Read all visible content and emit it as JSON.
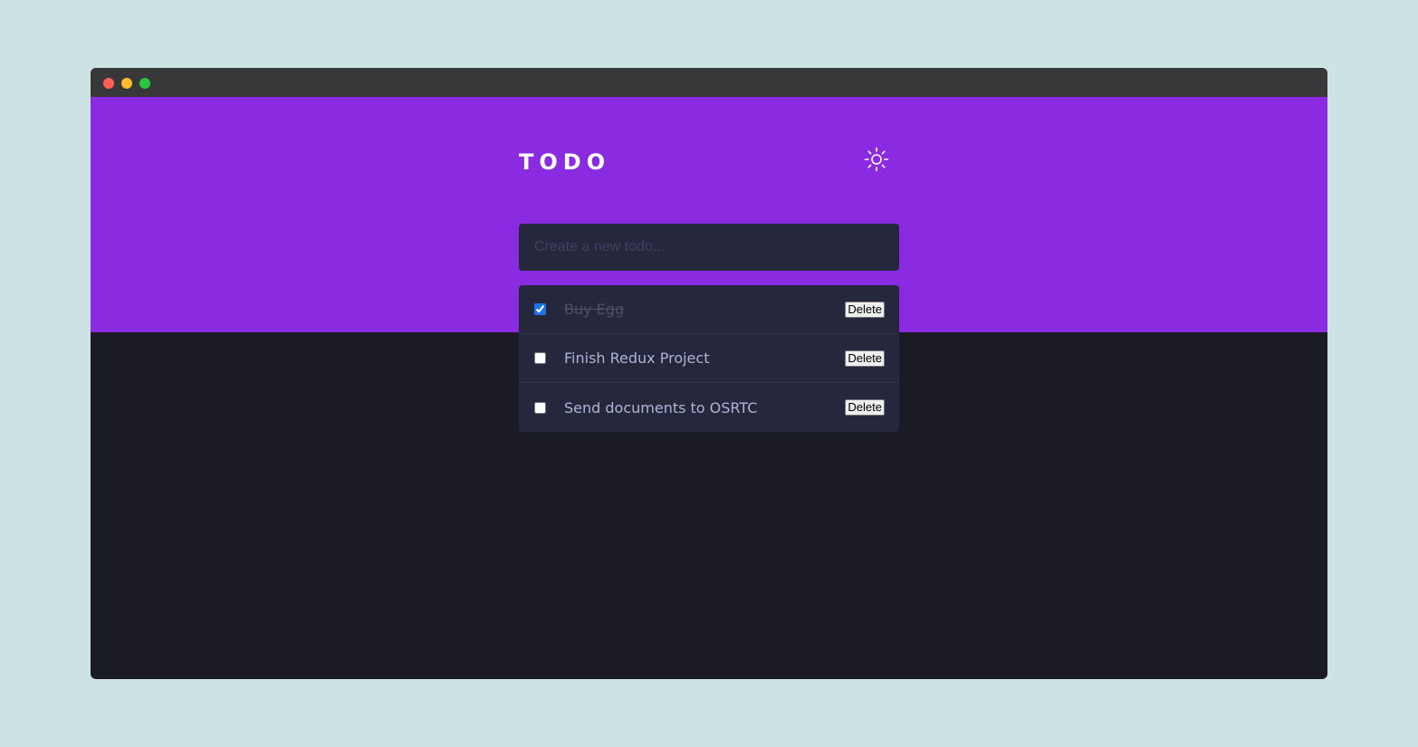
{
  "colors": {
    "page_background": "#cce2e3",
    "titlebar": "#38383a",
    "hero_background": "#8a2be2",
    "app_background": "#1a1b24",
    "panel": "#25273d",
    "close_dot": "#fe5f57",
    "minimize_dot": "#febc2e",
    "maximize_dot": "#28c840"
  },
  "header": {
    "title": "TODO",
    "theme_icon": "sun-icon"
  },
  "new_todo": {
    "placeholder": "Create a new todo...",
    "value": ""
  },
  "todos": [
    {
      "text": "Buy Egg",
      "completed": true,
      "delete_label": "Delete"
    },
    {
      "text": "Finish Redux Project",
      "completed": false,
      "delete_label": "Delete"
    },
    {
      "text": "Send documents to OSRTC",
      "completed": false,
      "delete_label": "Delete"
    }
  ]
}
